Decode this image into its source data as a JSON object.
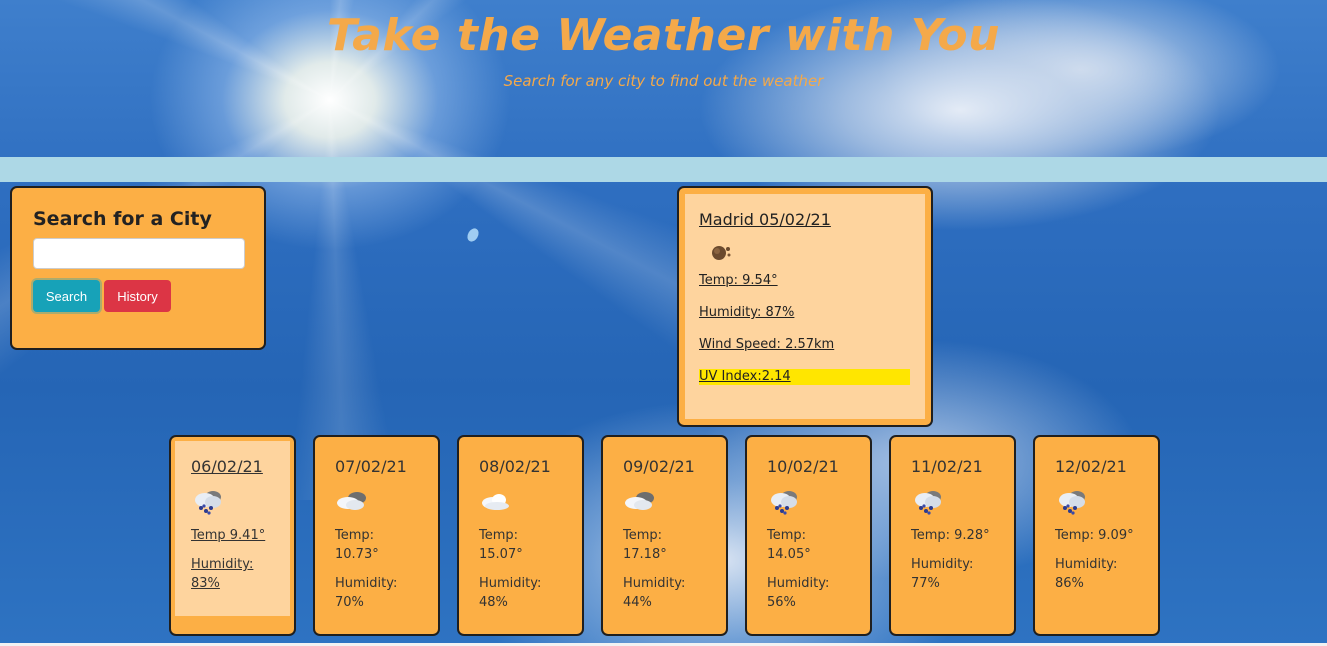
{
  "header": {
    "title": "Take the Weather with You",
    "subtitle": "Search for any city to find out the weather"
  },
  "search": {
    "heading": "Search for a City",
    "input_value": "",
    "input_placeholder": "",
    "search_label": "Search",
    "history_label": "History"
  },
  "current": {
    "title": "Madrid 05/02/21",
    "icon": "moon-dust-icon",
    "temp": "Temp: 9.54°",
    "humidity": "Humidity: 87%",
    "wind": "Wind Speed: 2.57km",
    "uv": "UV Index:2.14",
    "uv_color": "#ffe600"
  },
  "forecast": [
    {
      "date": "06/02/21",
      "icon": "rain-cloud-icon",
      "temp": "Temp 9.41°",
      "humidity": "Humidity: 83%"
    },
    {
      "date": "07/02/21",
      "icon": "partly-cloudy-icon",
      "temp": "Temp: 10.73°",
      "humidity": "Humidity: 70%"
    },
    {
      "date": "08/02/21",
      "icon": "cloud-icon",
      "temp": "Temp: 15.07°",
      "humidity": "Humidity: 48%"
    },
    {
      "date": "09/02/21",
      "icon": "partly-cloudy-icon",
      "temp": "Temp: 17.18°",
      "humidity": "Humidity: 44%"
    },
    {
      "date": "10/02/21",
      "icon": "rain-cloud-icon",
      "temp": "Temp: 14.05°",
      "humidity": "Humidity: 56%"
    },
    {
      "date": "11/02/21",
      "icon": "rain-cloud-icon",
      "temp": "Temp: 9.28°",
      "humidity": "Humidity: 77%"
    },
    {
      "date": "12/02/21",
      "icon": "rain-cloud-icon",
      "temp": "Temp: 9.09°",
      "humidity": "Humidity: 86%"
    }
  ],
  "colors": {
    "title": "#f4a94a",
    "card": "#fcaf45",
    "card_highlight": "#fed49e",
    "band": "#add8e6",
    "search_button": "#17a2b8",
    "history_button": "#dc3545"
  }
}
